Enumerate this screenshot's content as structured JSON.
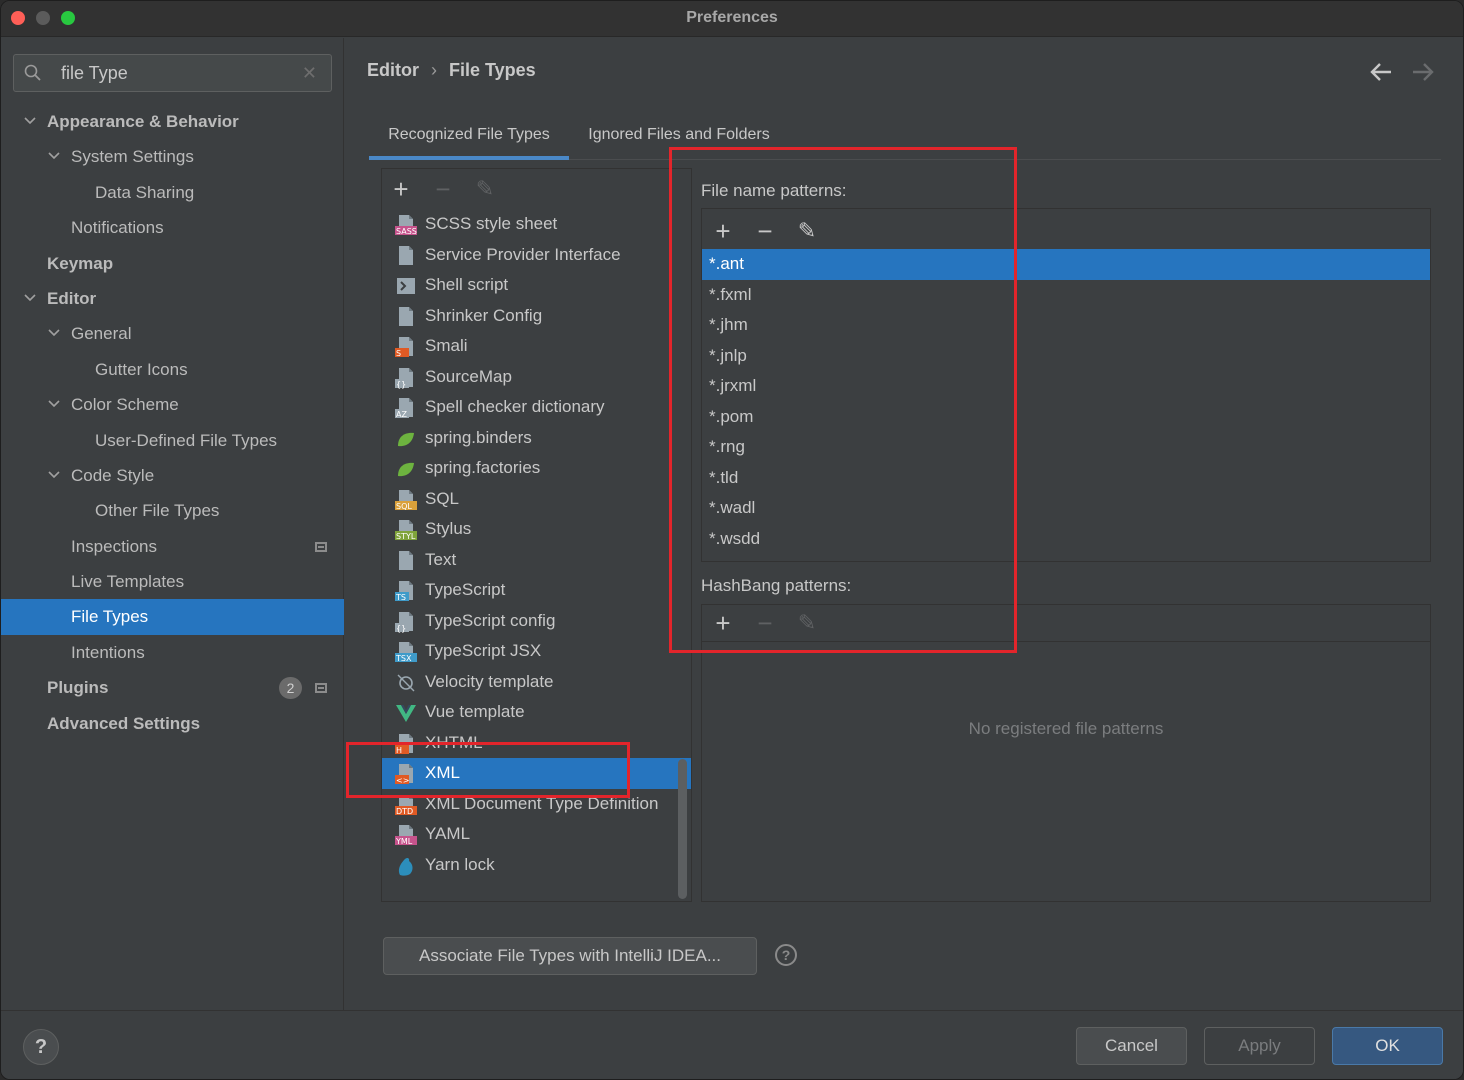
{
  "window": {
    "title": "Preferences"
  },
  "search": {
    "value": "file Type",
    "clear_glyph": "✕"
  },
  "sidebar": {
    "items": [
      {
        "label": "Appearance & Behavior",
        "level": 0,
        "bold": true,
        "expanded": true
      },
      {
        "label": "System Settings",
        "level": 1,
        "expanded": true
      },
      {
        "label": "Data Sharing",
        "level": 2
      },
      {
        "label": "Notifications",
        "level": 1
      },
      {
        "label": "Keymap",
        "level": 0,
        "bold": true
      },
      {
        "label": "Editor",
        "level": 0,
        "bold": true,
        "expanded": true
      },
      {
        "label": "General",
        "level": 1,
        "expanded": true
      },
      {
        "label": "Gutter Icons",
        "level": 2
      },
      {
        "label": "Color Scheme",
        "level": 1,
        "expanded": true
      },
      {
        "label": "User-Defined File Types",
        "level": 2
      },
      {
        "label": "Code Style",
        "level": 1,
        "expanded": true
      },
      {
        "label": "Other File Types",
        "level": 2
      },
      {
        "label": "Inspections",
        "level": 1,
        "pin": true
      },
      {
        "label": "Live Templates",
        "level": 1
      },
      {
        "label": "File Types",
        "level": 1,
        "selected": true
      },
      {
        "label": "Intentions",
        "level": 1
      },
      {
        "label": "Plugins",
        "level": 0,
        "bold": true,
        "badge": "2",
        "pin": true
      },
      {
        "label": "Advanced Settings",
        "level": 0,
        "bold": true
      }
    ]
  },
  "breadcrumb": {
    "parent": "Editor",
    "current": "File Types",
    "separator": "›"
  },
  "tabs": [
    {
      "label": "Recognized File Types",
      "active": true
    },
    {
      "label": "Ignored Files and Folders",
      "active": false
    }
  ],
  "toolbar": {
    "add": "+",
    "remove": "−",
    "edit": "✎"
  },
  "file_types": [
    {
      "label": "SCSS style sheet",
      "icon": "sass-icon",
      "tag": "SASS",
      "color": "#c6538c"
    },
    {
      "label": "Service Provider Interface",
      "icon": "file-icon",
      "tag": "",
      "color": ""
    },
    {
      "label": "Shell script",
      "icon": "shell-icon",
      "tag": ">",
      "color": "#9aa7b0"
    },
    {
      "label": "Shrinker Config",
      "icon": "file-icon",
      "tag": "",
      "color": ""
    },
    {
      "label": "Smali",
      "icon": "smali-icon",
      "tag": "S",
      "color": "#e05a24"
    },
    {
      "label": "SourceMap",
      "icon": "json-icon",
      "tag": "{}",
      "color": "#9aa7b0"
    },
    {
      "label": "Spell checker dictionary",
      "icon": "dictionary-icon",
      "tag": "AZ",
      "color": "#9aa7b0"
    },
    {
      "label": "spring.binders",
      "icon": "spring-leaf-icon",
      "tag": "",
      "color": "#6db33f"
    },
    {
      "label": "spring.factories",
      "icon": "spring-leaf-icon",
      "tag": "",
      "color": "#6db33f"
    },
    {
      "label": "SQL",
      "icon": "sql-icon",
      "tag": "SQL",
      "color": "#d9a03a"
    },
    {
      "label": "Stylus",
      "icon": "stylus-icon",
      "tag": "STYL",
      "color": "#7fa33a"
    },
    {
      "label": "Text",
      "icon": "text-file-icon",
      "tag": "",
      "color": ""
    },
    {
      "label": "TypeScript",
      "icon": "typescript-icon",
      "tag": "TS",
      "color": "#3f9bc9"
    },
    {
      "label": "TypeScript config",
      "icon": "json-icon",
      "tag": "{}",
      "color": "#9aa7b0"
    },
    {
      "label": "TypeScript JSX",
      "icon": "tsx-icon",
      "tag": "TSX",
      "color": "#3f9bc9"
    },
    {
      "label": "Velocity template",
      "icon": "velocity-icon",
      "tag": "",
      "color": "#9aa7b0"
    },
    {
      "label": "Vue template",
      "icon": "vue-icon",
      "tag": "",
      "color": "#41b883"
    },
    {
      "label": "XHTML",
      "icon": "html-icon",
      "tag": "H",
      "color": "#e05a24"
    },
    {
      "label": "XML",
      "icon": "xml-icon",
      "tag": "<>",
      "color": "#e05a24",
      "selected": true
    },
    {
      "label": "XML Document Type Definition",
      "icon": "dtd-icon",
      "tag": "DTD",
      "color": "#e05a24"
    },
    {
      "label": "YAML",
      "icon": "yaml-icon",
      "tag": "YML",
      "color": "#c6538c"
    },
    {
      "label": "Yarn lock",
      "icon": "yarn-icon",
      "tag": "",
      "color": "#2c8ebb"
    }
  ],
  "file_name_patterns": {
    "label": "File name patterns:",
    "items": [
      "*.ant",
      "*.fxml",
      "*.jhm",
      "*.jnlp",
      "*.jrxml",
      "*.pom",
      "*.rng",
      "*.tld",
      "*.wadl",
      "*.wsdd"
    ],
    "selected_index": 0
  },
  "hashbang_patterns": {
    "label": "HashBang patterns:",
    "empty_text": "No registered file patterns"
  },
  "associate_button": "Associate File Types with IntelliJ IDEA...",
  "help_glyph": "?",
  "footer": {
    "cancel": "Cancel",
    "apply": "Apply",
    "ok": "OK",
    "help": "?"
  },
  "colors": {
    "accent": "#2675bf",
    "annotation": "#e3252b",
    "background": "#3c3f41"
  }
}
